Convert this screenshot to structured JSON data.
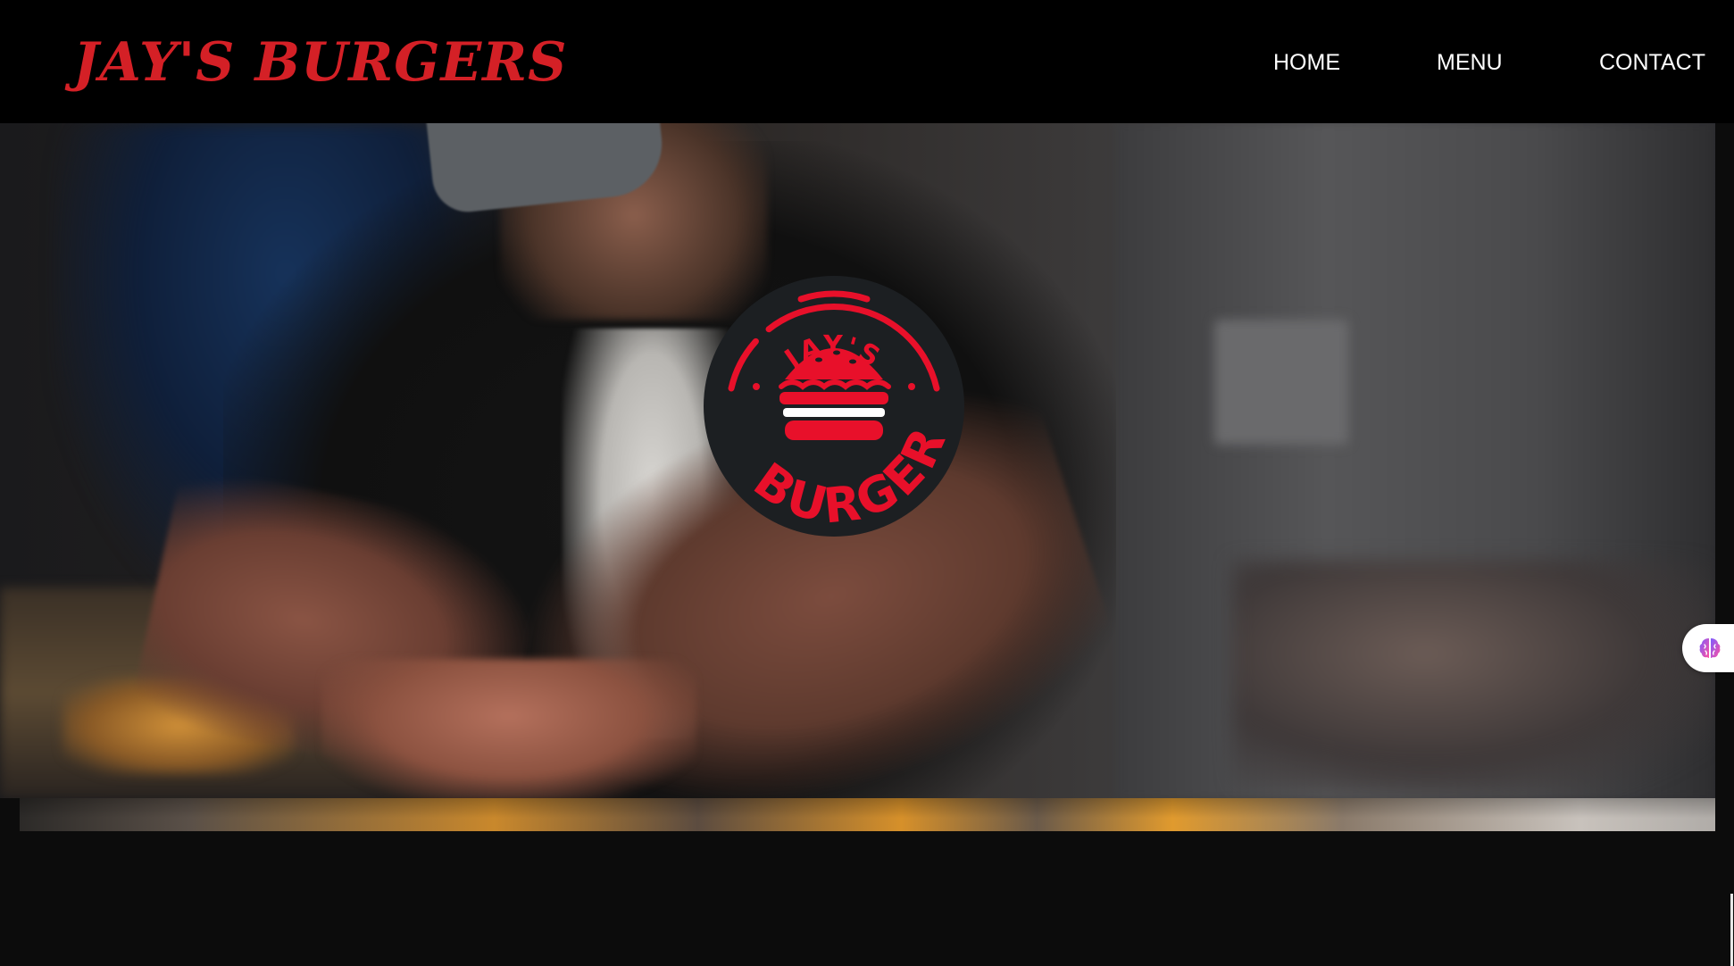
{
  "header": {
    "brand": "JAY'S BURGERS",
    "nav": [
      {
        "label": "HOME"
      },
      {
        "label": "MENU"
      },
      {
        "label": "CONTACT"
      }
    ]
  },
  "hero": {
    "logo": {
      "top_text": "JAY'S",
      "bottom_text": "BURGER",
      "colors": {
        "ring": "#e8102a",
        "bg": "#1c1f22"
      }
    }
  },
  "widget": {
    "icon": "brain-icon"
  },
  "colors": {
    "brand_red": "#d42026",
    "header_bg": "#000000",
    "page_bg": "#0c0c0c",
    "nav_text": "#ffffff"
  }
}
